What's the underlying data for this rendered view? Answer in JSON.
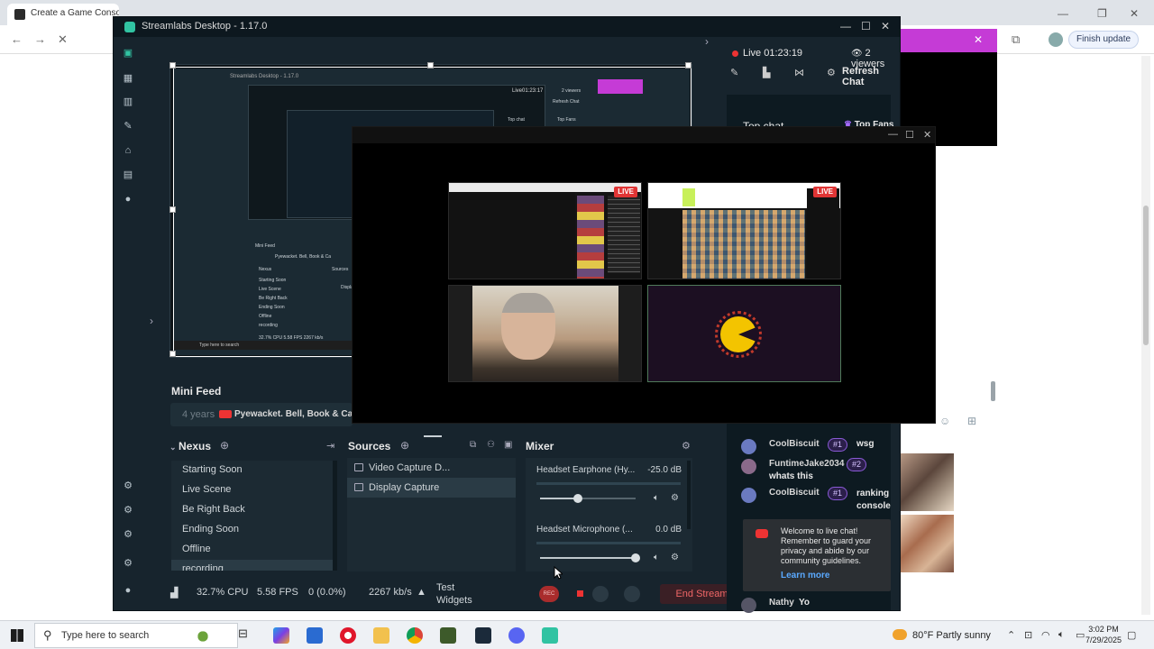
{
  "browser": {
    "tab_title": "Create a Game Consoles",
    "finish_update": "Finish update"
  },
  "streamlabs": {
    "window_title": "Streamlabs Desktop - 1.17.0",
    "mini_feed": {
      "title": "Mini Feed",
      "ago": "4 years",
      "message": "Pyewacket. Bell, Book & Car"
    },
    "scenes": {
      "header": "Nexus",
      "items": [
        "Starting Soon",
        "Live Scene",
        "Be Right Back",
        "Ending Soon",
        "Offline",
        "recording"
      ],
      "selected_index": 5
    },
    "sources": {
      "header": "Sources",
      "items": [
        {
          "label": "Video Capture D...",
          "icon": "camera-icon"
        },
        {
          "label": "Display Capture",
          "icon": "monitor-icon"
        }
      ]
    },
    "mixer": {
      "header": "Mixer",
      "channels": [
        {
          "name": "Headset Earphone (Hy...",
          "db": "-25.0 dB",
          "level": 0.4
        },
        {
          "name": "Headset Microphone (...",
          "db": "0.0 dB",
          "level": 1.0
        }
      ]
    },
    "status": {
      "cpu": "32.7% CPU",
      "fps": "5.58 FPS",
      "dropped": "0 (0.0%)",
      "bitrate": "2267 kb/s",
      "test_widgets": "Test Widgets",
      "rec": "REC",
      "end_stream": "End Stream"
    }
  },
  "chat": {
    "live_time": "Live 01:23:19",
    "viewers": "2 viewers",
    "refresh_chat": "Refresh Chat",
    "top_chat": "Top chat",
    "top_fans": "Top Fans",
    "messages": [
      {
        "name": "CoolBiscuit",
        "badge": "#1",
        "text": "wsg"
      },
      {
        "name": "FuntimeJake2034",
        "badge": "#2",
        "text": "whats this"
      },
      {
        "name": "CoolBiscuit",
        "badge": "#1",
        "text": "ranking console"
      }
    ],
    "welcome": "Welcome to live chat! Remember to guard your privacy and abide by our community guidelines.",
    "learn_more": "Learn more",
    "last_message": {
      "name": "Nathy",
      "text": "Yo"
    }
  },
  "preview": {
    "mini_feed": "Mini Feed",
    "mini_scenes": [
      "Starting Soon",
      "Live Scene",
      "Be Right Back",
      "Ending Soon",
      "Offline",
      "recording"
    ],
    "mini_nexus": "Nexus",
    "mini_sources": "Sources",
    "mini_display": "Display",
    "mini_msg": "Pyewacket. Bell, Book & Ca",
    "mini_stats": "32.7% CPU   5.58 FPS   2267 kb/s",
    "mini_title": "Streamlabs Desktop - 1.17.0",
    "mini_live": "Live01:23:17",
    "mini_viewers": "2 viewers",
    "mini_top_chat": "Top chat",
    "mini_top_fans": "Top Fans",
    "mini_refresh": "Refresh Chat",
    "mini_search": "Type here to search"
  },
  "popout": {
    "live_badge": "LIVE"
  },
  "taskbar": {
    "search_placeholder": "Type here to search",
    "weather": "80°F  Partly sunny",
    "time": "3:02 PM",
    "date": "7/29/2025"
  },
  "colors": {
    "accent": "#31c3a2",
    "live_red": "#e03535",
    "panel_bg": "#17242d",
    "end_stream": "#f06767",
    "magenta": "#c53bd6"
  }
}
